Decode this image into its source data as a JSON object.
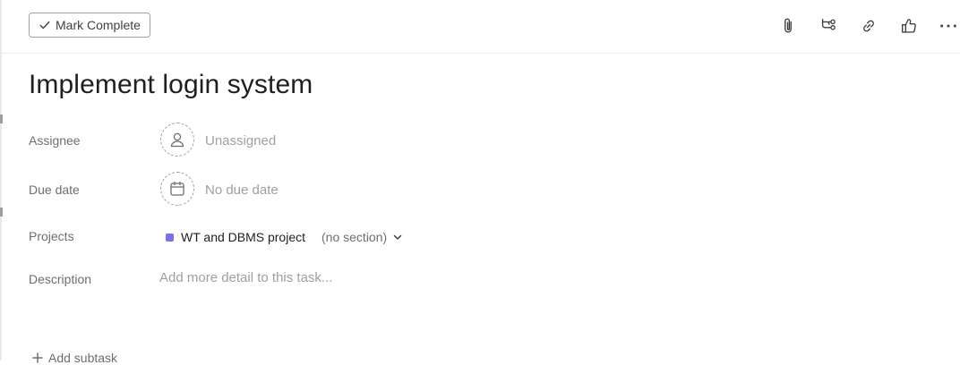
{
  "toolbar": {
    "mark_complete_label": "Mark Complete",
    "icons": [
      "paperclip-icon",
      "subtask-icon",
      "link-icon",
      "thumbs-up-icon",
      "more-icon"
    ]
  },
  "task": {
    "title": "Implement login system"
  },
  "fields": {
    "assignee_label": "Assignee",
    "assignee_value": "Unassigned",
    "due_date_label": "Due date",
    "due_date_value": "No due date",
    "projects_label": "Projects",
    "project_name": "WT and DBMS project",
    "project_color": "#7a6ff0",
    "project_section": "(no section)",
    "description_label": "Description",
    "description_placeholder": "Add more detail to this task..."
  },
  "subtasks": {
    "add_label": "Add subtask"
  }
}
